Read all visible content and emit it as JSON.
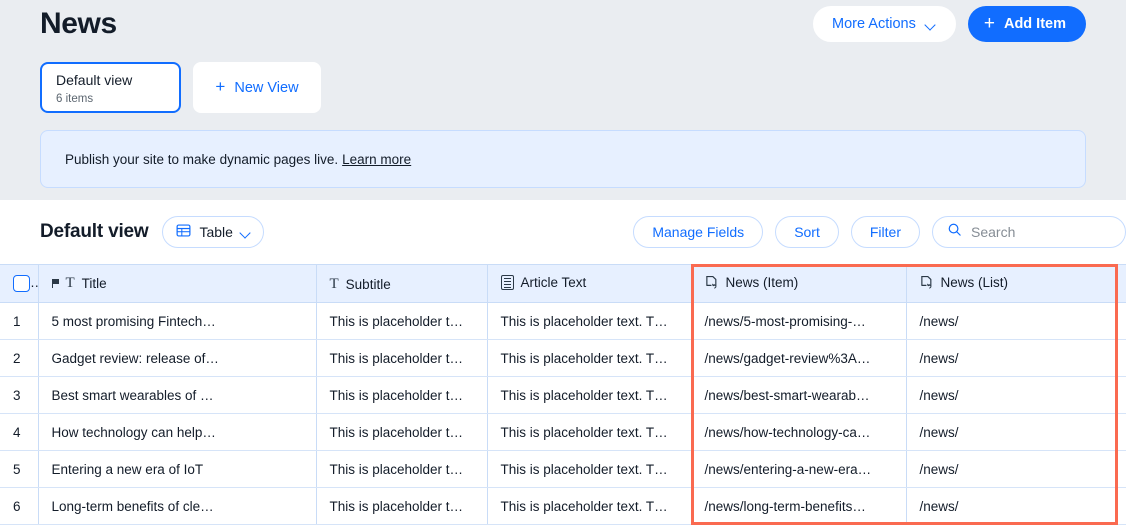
{
  "header": {
    "title": "News",
    "more_actions_label": "More Actions",
    "add_item_label": "Add Item",
    "plus_glyph": "+",
    "chevron_icon": "chevron-down-icon"
  },
  "views": {
    "default_view": {
      "name": "Default view",
      "count_label": "6 items"
    },
    "new_view_label": "New View",
    "new_view_plus": "+"
  },
  "banner": {
    "text": "Publish your site to make dynamic pages live.",
    "link_label": "Learn more"
  },
  "toolbar": {
    "view_title": "Default view",
    "layout_label": "Table",
    "layout_icon": "table-icon",
    "manage_fields_label": "Manage Fields",
    "sort_label": "Sort",
    "filter_label": "Filter",
    "search": {
      "placeholder": "Search",
      "value": "",
      "icon": "search-icon"
    }
  },
  "table": {
    "select_all_checkbox": "",
    "columns": [
      {
        "label": "Title",
        "icon": "text-field-icon",
        "primary": true,
        "flag": true
      },
      {
        "label": "Subtitle",
        "icon": "text-field-icon",
        "primary": false,
        "flag": false
      },
      {
        "label": "Article Text",
        "icon": "rich-text-icon",
        "primary": false,
        "flag": false
      },
      {
        "label": "News (Item)",
        "icon": "dynamic-page-icon",
        "primary": false,
        "flag": false
      },
      {
        "label": "News (List)",
        "icon": "dynamic-page-icon",
        "primary": false,
        "flag": false
      }
    ],
    "rows": [
      {
        "num": "1",
        "title": "5 most promising Fintech…",
        "subtitle": "This is placeholder t…",
        "article": "This is placeholder text. T…",
        "item": "/news/5-most-promising-…",
        "list": "/news/"
      },
      {
        "num": "2",
        "title": "Gadget review: release of…",
        "subtitle": "This is placeholder t…",
        "article": "This is placeholder text. T…",
        "item": "/news/gadget-review%3A…",
        "list": "/news/"
      },
      {
        "num": "3",
        "title": "Best smart wearables of …",
        "subtitle": "This is placeholder t…",
        "article": "This is placeholder text. T…",
        "item": "/news/best-smart-wearab…",
        "list": "/news/"
      },
      {
        "num": "4",
        "title": "How technology can help…",
        "subtitle": "This is placeholder t…",
        "article": "This is placeholder text. T…",
        "item": "/news/how-technology-ca…",
        "list": "/news/"
      },
      {
        "num": "5",
        "title": "Entering a new era of IoT",
        "subtitle": "This is placeholder t…",
        "article": "This is placeholder text. T…",
        "item": "/news/entering-a-new-era…",
        "list": "/news/"
      },
      {
        "num": "6",
        "title": "Long-term benefits of cle…",
        "subtitle": "This is placeholder t…",
        "article": "This is placeholder text. T…",
        "item": "/news/long-term-benefits…",
        "list": "/news/"
      }
    ]
  },
  "colors": {
    "accent": "#116dff",
    "highlight": "#fa6a50",
    "header_bg": "#eaedf1",
    "banner_bg": "#e7f0ff"
  }
}
